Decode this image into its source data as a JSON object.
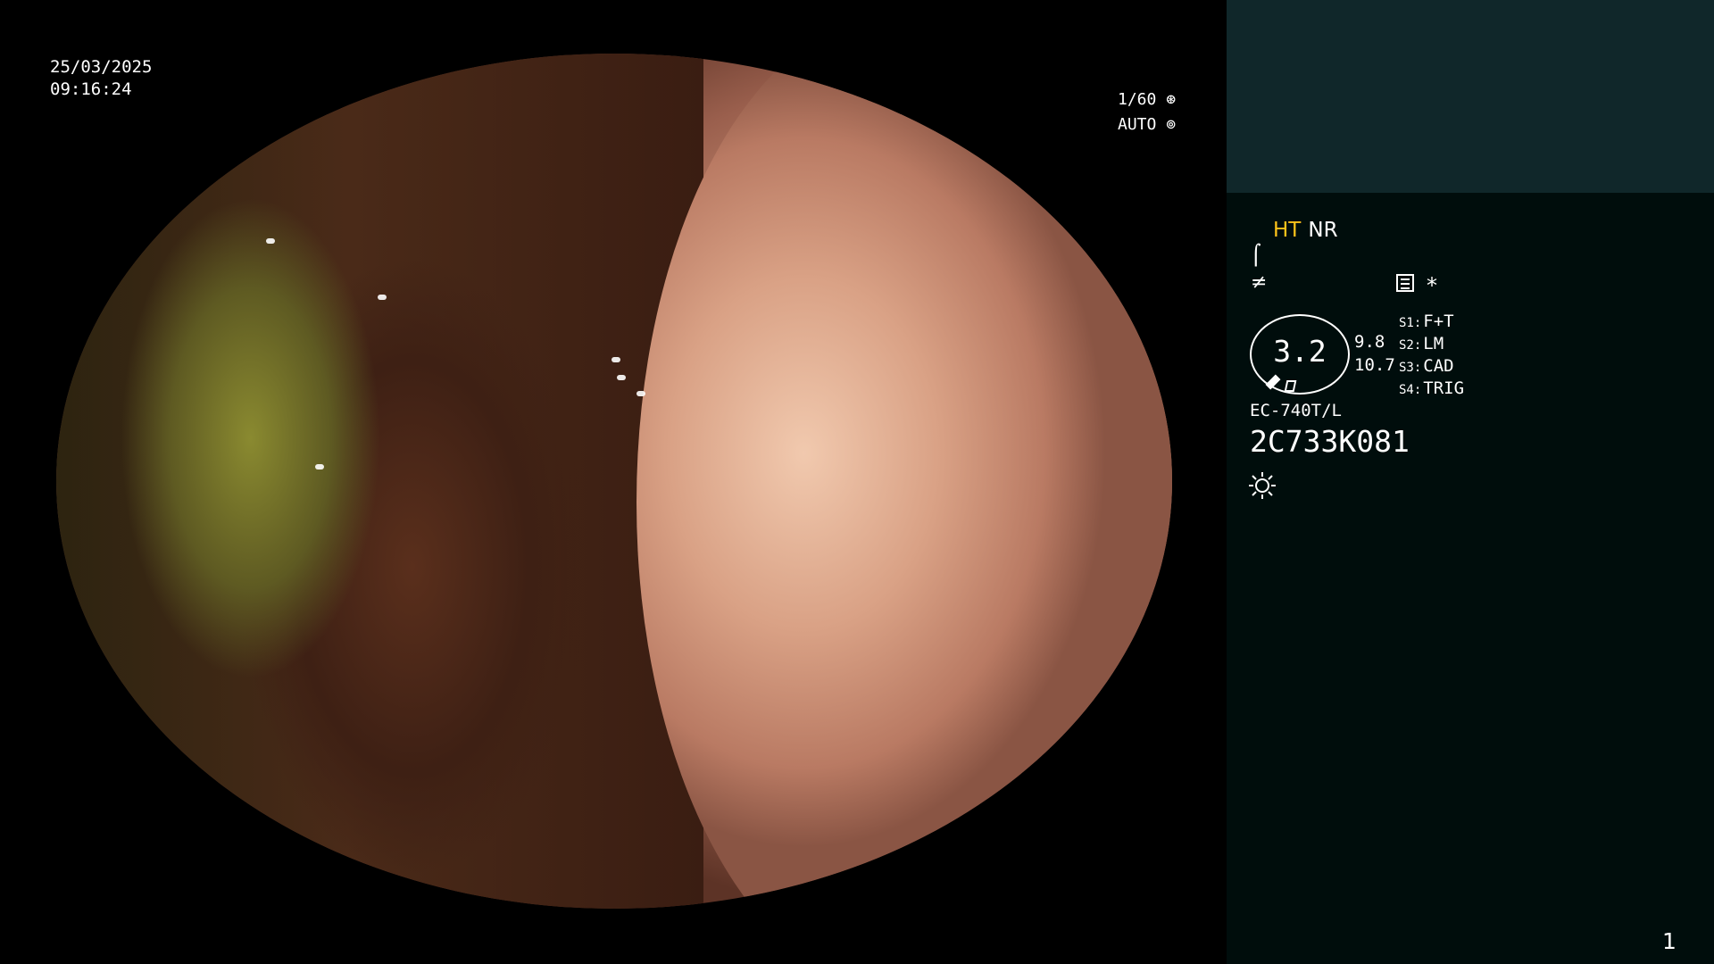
{
  "overlay": {
    "date": "25/03/2025",
    "time": "09:16:24",
    "shutter": "1/60",
    "shutter_icon": "aperture-icon",
    "exposure": "AUTO",
    "exposure_icon": "iris-icon"
  },
  "panel": {
    "mode_ht": "HT",
    "mode_nr": "NR",
    "icons": [
      "focus-icon",
      "enhance-icon",
      "menu-icon",
      "asterisk-icon"
    ],
    "asterisk": "*",
    "gauge": {
      "value": "3.2",
      "right_top": "9.8",
      "right_bottom": "10.7"
    },
    "switches": [
      {
        "key": "S1:",
        "value": "F+T"
      },
      {
        "key": "S2:",
        "value": "LM"
      },
      {
        "key": "S3:",
        "value": "CAD"
      },
      {
        "key": "S4:",
        "value": "TRIG"
      }
    ],
    "model": "EC-740T/L",
    "serial": "2C733K081",
    "light_icon": "sun-icon",
    "page_number": "1"
  },
  "colors": {
    "panel_bg": "#000d0c",
    "panel_top_bg": "#10272a",
    "ht_accent": "#ffc21a"
  }
}
